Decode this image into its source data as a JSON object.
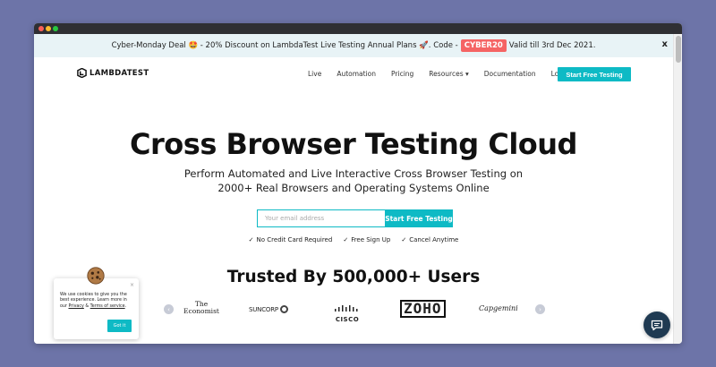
{
  "promo": {
    "text_before": "Cyber-Monday Deal 🤩 - 20% Discount on LambdaTest Live Testing Annual Plans 🚀. Code - ",
    "code": "CYBER20",
    "text_after": " Valid till 3rd Dec 2021.",
    "close": "x"
  },
  "nav": {
    "logo_text": "LAMBDATEST",
    "items": [
      "Live",
      "Automation",
      "Pricing",
      "Resources",
      "Documentation",
      "Login"
    ],
    "resources_caret": "▾",
    "cta": "Start Free Testing"
  },
  "hero": {
    "title": "Cross Browser Testing Cloud",
    "subtitle_line1": "Perform Automated and Live Interactive Cross Browser Testing on",
    "subtitle_line2": "2000+ Real Browsers and Operating Systems Online"
  },
  "signup": {
    "email_placeholder": "Your email address",
    "button": "Start Free Testing"
  },
  "perks": [
    {
      "check": "✓",
      "label": "No Credit Card Required"
    },
    {
      "check": "✓",
      "label": "Free Sign Up"
    },
    {
      "check": "✓",
      "label": "Cancel Anytime"
    }
  ],
  "trusted": {
    "title": "Trusted By 500,000+ Users",
    "brands": [
      "The Economist",
      "SUNCORP",
      "CISCO",
      "ZOHO",
      "Capgemini"
    ],
    "prev": "‹",
    "next": "›"
  },
  "cookie": {
    "close": "×",
    "text_main": "We use cookies to give you the best experience. Learn more in our ",
    "privacy": "Privacy",
    "amp": " & ",
    "terms": "Terms of service",
    "period": ".",
    "button": "Got it"
  },
  "colors": {
    "accent": "#0ebac5",
    "promo_code_bg": "#f56464",
    "background": "#6d74a8",
    "chat_bg": "#1f3a52"
  }
}
